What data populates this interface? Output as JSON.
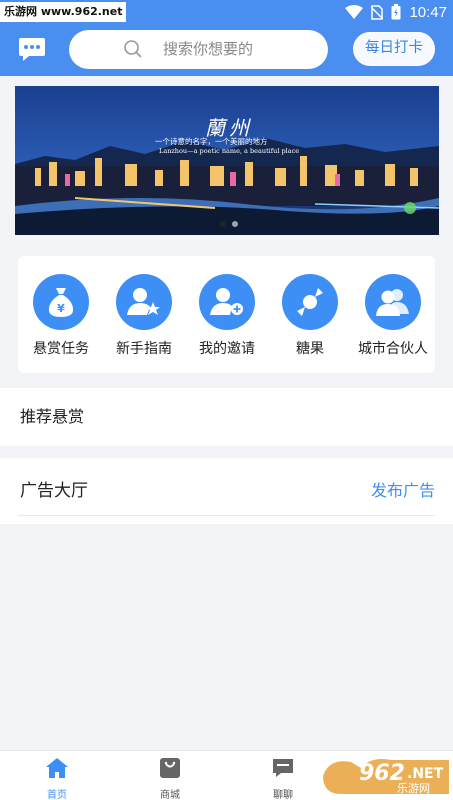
{
  "status_bar": {
    "watermark_text": "乐游网 www.962.net",
    "time": "10:47"
  },
  "header": {
    "search_placeholder": "搜索你想要的",
    "checkin_label": "每日打卡"
  },
  "banner": {
    "title": "蘭州",
    "subtitle": "一个诗意的名字，一个美丽的地方",
    "subtitle_en": "Lanzhou—a poetic name, a beautiful place"
  },
  "quick_menu": {
    "items": [
      {
        "label": "悬赏任务",
        "icon": "money-bag-icon"
      },
      {
        "label": "新手指南",
        "icon": "user-star-icon"
      },
      {
        "label": "我的邀请",
        "icon": "user-add-icon"
      },
      {
        "label": "糖果",
        "icon": "candy-icon"
      },
      {
        "label": "城市合伙人",
        "icon": "users-icon"
      }
    ]
  },
  "recommended": {
    "title": "推荐悬赏"
  },
  "ads": {
    "title": "广告大厅",
    "action": "发布广告"
  },
  "tab_bar": {
    "tabs": [
      {
        "label": "首页",
        "icon": "home-icon",
        "active": true
      },
      {
        "label": "商城",
        "icon": "shop-bag-icon",
        "active": false
      },
      {
        "label": "聊聊",
        "icon": "chat-icon",
        "active": false
      }
    ]
  },
  "watermark_logo": "962.NET 乐游网",
  "colors": {
    "primary": "#4a8ff0",
    "accent": "#3d8ff5"
  }
}
